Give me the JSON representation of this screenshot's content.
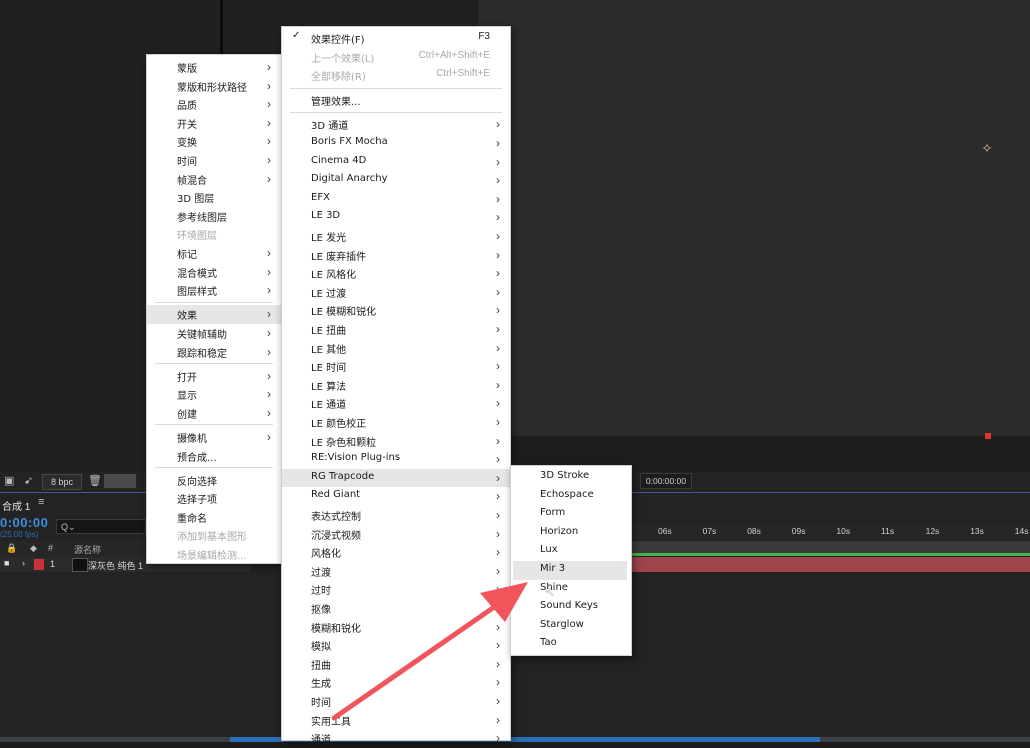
{
  "app": {
    "bpc_label": "8 bpc",
    "timecode_small": "0:00:00:00",
    "comp_tab": "合成 1",
    "big_time": "0:00:00",
    "fps": "(25.00 fps)",
    "search_placeholder": "Q⌄",
    "layer_header": "源名称",
    "layer_num": "1",
    "layer_name": "深灰色 纯色 1",
    "ruler_ticks": [
      "06s",
      "07s",
      "08s",
      "09s",
      "10s",
      "11s",
      "12s",
      "13s",
      "14s"
    ],
    "colors": {
      "accent_blue": "#3d8fe0",
      "layer_red": "#a0434a",
      "arrow_red": "#f2545b"
    }
  },
  "layer_menu": {
    "items": [
      {
        "label": "蒙版",
        "submenu": true
      },
      {
        "label": "蒙版和形状路径",
        "submenu": true
      },
      {
        "label": "品质",
        "submenu": true
      },
      {
        "label": "开关",
        "submenu": true
      },
      {
        "label": "变换",
        "submenu": true
      },
      {
        "label": "时间",
        "submenu": true
      },
      {
        "label": "帧混合",
        "submenu": true
      },
      {
        "label": "3D 图层",
        "submenu": false
      },
      {
        "label": "参考线图层",
        "submenu": false
      },
      {
        "label": "环境图层",
        "submenu": false,
        "disabled": true
      },
      {
        "label": "标记",
        "submenu": true
      },
      {
        "label": "混合模式",
        "submenu": true
      },
      {
        "label": "图层样式",
        "submenu": true
      },
      {
        "label": "效果",
        "submenu": true,
        "highlight": true
      },
      {
        "label": "关键帧辅助",
        "submenu": true
      },
      {
        "label": "跟踪和稳定",
        "submenu": true
      },
      {
        "label": "打开",
        "submenu": true
      },
      {
        "label": "显示",
        "submenu": true
      },
      {
        "label": "创建",
        "submenu": true
      },
      {
        "label": "摄像机",
        "submenu": true
      },
      {
        "label": "预合成...",
        "submenu": false
      },
      {
        "label": "反向选择",
        "submenu": false
      },
      {
        "label": "选择子项",
        "submenu": false
      },
      {
        "label": "重命名",
        "submenu": false
      },
      {
        "label": "添加到基本图形",
        "submenu": false,
        "disabled": true
      },
      {
        "label": "场景编辑检测...",
        "submenu": false,
        "disabled": true
      }
    ]
  },
  "effects_menu": {
    "top_items": [
      {
        "label": "效果控件(F)",
        "shortcut": "F3",
        "checked": true
      },
      {
        "label": "上一个效果(L)",
        "shortcut": "Ctrl+Alt+Shift+E",
        "disabled": true
      },
      {
        "label": "全部移除(R)",
        "shortcut": "Ctrl+Shift+E",
        "disabled": true
      },
      {
        "label": "管理效果..."
      }
    ],
    "items": [
      "3D 通道",
      "Boris FX Mocha",
      "Cinema 4D",
      "Digital Anarchy",
      "EFX",
      "LE 3D",
      "LE 发光",
      "LE 废弃插件",
      "LE 风格化",
      "LE 过渡",
      "LE 模糊和锐化",
      "LE 扭曲",
      "LE 其他",
      "LE 时间",
      "LE 算法",
      "LE 通道",
      "LE 颜色校正",
      "LE 杂色和颗粒",
      "RE:Vision Plug-ins",
      "RG Trapcode",
      "Red Giant",
      "表达式控制",
      "沉浸式视频",
      "风格化",
      "过渡",
      "过时",
      "抠像",
      "模糊和锐化",
      "模拟",
      "扭曲",
      "生成",
      "时间",
      "实用工具",
      "通道"
    ],
    "highlight_index": 19
  },
  "trapcode_menu": {
    "items": [
      "3D Stroke",
      "Echospace",
      "Form",
      "Horizon",
      "Lux",
      "Mir 3",
      "Shine",
      "Sound Keys",
      "Starglow",
      "Tao"
    ],
    "highlight_index": 5
  }
}
